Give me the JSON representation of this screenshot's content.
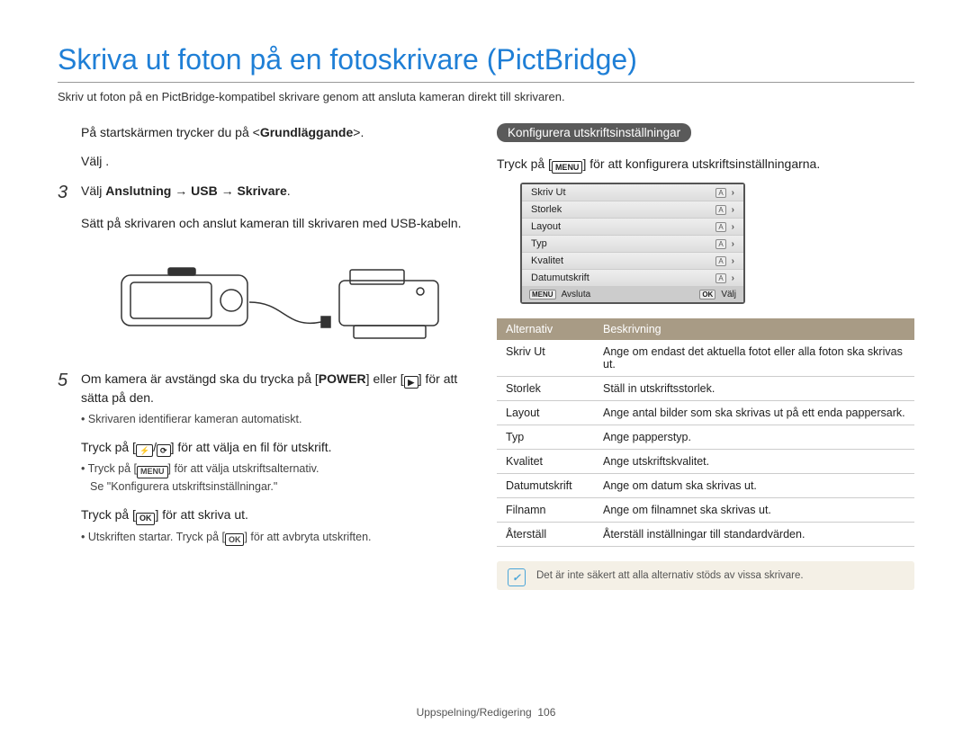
{
  "title": "Skriva ut foton på en fotoskrivare (PictBridge)",
  "subtitle": "Skriv ut foton på en PictBridge-kompatibel skrivare genom att ansluta kameran direkt till skrivaren.",
  "left": {
    "step1_a": "På startskärmen trycker du på <",
    "step1_b": "Grundläggande",
    "step1_c": ">.",
    "step2": "Välj      .",
    "step3_a": "Välj ",
    "step3_b": "Anslutning",
    "step3_c": " → ",
    "step3_d": "USB",
    "step3_e": " → ",
    "step3_f": "Skrivare",
    "step3_g": ".",
    "step4": "Sätt på skrivaren och anslut kameran till skrivaren med USB-kabeln.",
    "step5_a": "Om kamera är avstängd ska du trycka på [",
    "step5_b": "POWER",
    "step5_c": "] eller [",
    "step5_d": "] för att sätta på den.",
    "step5_sub": "Skrivaren identifierar kameran automatiskt.",
    "step6_a": "Tryck på [",
    "step6_b": "] för att välja en fil för utskrift.",
    "step6_sub_a": "Tryck på [",
    "step6_sub_b": "] för att välja utskriftsalternativ.",
    "step6_sub_c": "Se \"Konfigurera utskriftsinställningar.\"",
    "step7_a": "Tryck på [",
    "step7_b": "] för att skriva ut.",
    "step7_sub_a": "Utskriften startar. Tryck på [",
    "step7_sub_b": "] för att avbryta utskriften."
  },
  "right": {
    "heading": "Konfigurera utskriftsinställningar",
    "lead_a": "Tryck på [",
    "lead_b": "] för att konfigurera utskriftsinställningarna.",
    "menu_items": [
      "Skriv Ut",
      "Storlek",
      "Layout",
      "Typ",
      "Kvalitet",
      "Datumutskrift"
    ],
    "menu_exit": "Avsluta",
    "menu_select": "Välj",
    "table": {
      "h1": "Alternativ",
      "h2": "Beskrivning",
      "rows": [
        [
          "Skriv Ut",
          "Ange om endast det aktuella fotot eller alla foton ska skrivas ut."
        ],
        [
          "Storlek",
          "Ställ in utskriftsstorlek."
        ],
        [
          "Layout",
          "Ange antal bilder som ska skrivas ut på ett enda pappersark."
        ],
        [
          "Typ",
          "Ange papperstyp."
        ],
        [
          "Kvalitet",
          "Ange utskriftskvalitet."
        ],
        [
          "Datumutskrift",
          "Ange om datum ska skrivas ut."
        ],
        [
          "Filnamn",
          "Ange om filnamnet ska skrivas ut."
        ],
        [
          "Återställ",
          "Återställ inställningar till standardvärden."
        ]
      ]
    },
    "note": "Det är inte säkert att alla alternativ stöds av vissa skrivare."
  },
  "footer_a": "Uppspelning/Redigering",
  "footer_b": "106"
}
